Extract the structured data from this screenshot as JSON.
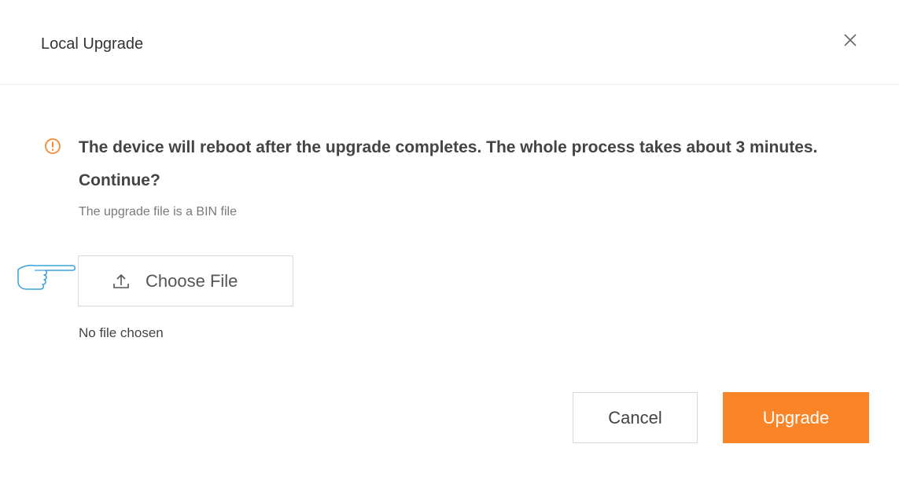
{
  "dialog": {
    "title": "Local Upgrade",
    "close_icon": "close-icon"
  },
  "warning": {
    "icon": "warning-circle-icon",
    "icon_color": "#f7882f",
    "message": "The device will reboot after the upgrade completes. The whole process takes about 3 minutes. Continue?",
    "hint": "The upgrade file is a BIN file"
  },
  "file": {
    "choose_label": "Choose File",
    "choose_icon": "upload-icon",
    "pointer_icon": "pointing-hand-icon",
    "status": "No file chosen"
  },
  "buttons": {
    "cancel_label": "Cancel",
    "upgrade_label": "Upgrade",
    "upgrade_color": "#fa8529"
  }
}
